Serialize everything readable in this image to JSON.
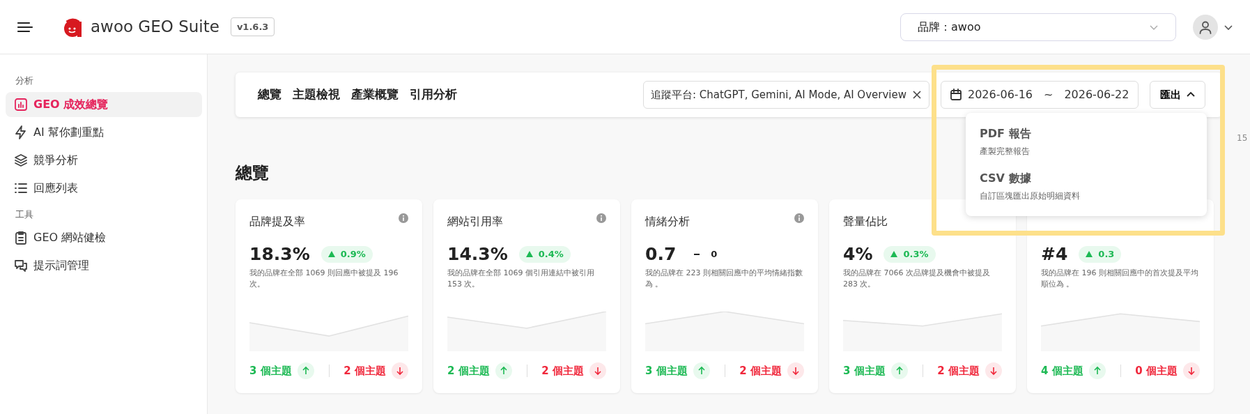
{
  "header": {
    "app_name": "awoo GEO Suite",
    "version": "v1.6.3",
    "brand_select": "品牌：awoo"
  },
  "sidebar": {
    "sections": [
      {
        "label": "分析",
        "items": [
          {
            "label": "GEO 成效總覽",
            "selected": true
          },
          {
            "label": "AI 幫你劃重點",
            "selected": false
          },
          {
            "label": "競爭分析",
            "selected": false
          },
          {
            "label": "回應列表",
            "selected": false
          }
        ]
      },
      {
        "label": "工具",
        "items": [
          {
            "label": "GEO 網站健檢",
            "selected": false
          },
          {
            "label": "提示詞管理",
            "selected": false
          }
        ]
      }
    ]
  },
  "toolbar": {
    "tabs": [
      "總覽",
      "主題檢視",
      "產業概覽",
      "引用分析"
    ],
    "platform_filter": "追蹤平台: ChatGPT, Gemini, AI Mode, AI Overview",
    "date_start": "2026-06-16",
    "date_separator": "~",
    "date_end": "2026-06-22",
    "export_button": "匯出",
    "export_menu_open": true
  },
  "export_menu": [
    {
      "title": "PDF 報告",
      "description": "產製完整報告"
    },
    {
      "title": "CSV 數據",
      "description": "自訂區塊匯出原始明細資料"
    }
  ],
  "update_note": "15",
  "section_title": "總覽",
  "cards": [
    {
      "title": "品牌提及率",
      "info": true,
      "value": "18.3%",
      "delta": "0.9%",
      "kind": "up",
      "description": "我的品牌在全部 1069 則回應中被提及 196 次。",
      "topics_up": "3 個主題",
      "topics_down": "2 個主題"
    },
    {
      "title": "網站引用率",
      "info": true,
      "value": "14.3%",
      "delta": "0.4%",
      "kind": "up",
      "description": "我的品牌在全部 1069 個引用連結中被引用 153 次。",
      "topics_up": "2 個主題",
      "topics_down": "2 個主題"
    },
    {
      "title": "情緒分析",
      "info": true,
      "value": "0.7",
      "delta": "0",
      "kind": "flat",
      "description": "我的品牌在 223 則相關回應中的平均情緒指數為 。",
      "topics_up": "3 個主題",
      "topics_down": "2 個主題"
    },
    {
      "title": "聲量佔比",
      "info": false,
      "value": "4%",
      "delta": "0.3%",
      "kind": "up",
      "description": "我的品牌在 7066 次品牌提及機會中被提及 283 次。",
      "topics_up": "3 個主題",
      "topics_down": "2 個主題"
    },
    {
      "info": false,
      "value": "#4",
      "delta": "0.3",
      "kind": "up",
      "description": "我的品牌在 196 則相關回應中的首次提及平均順位為 。",
      "topics_up": "4 個主題",
      "topics_down": "0 個主題"
    }
  ]
}
